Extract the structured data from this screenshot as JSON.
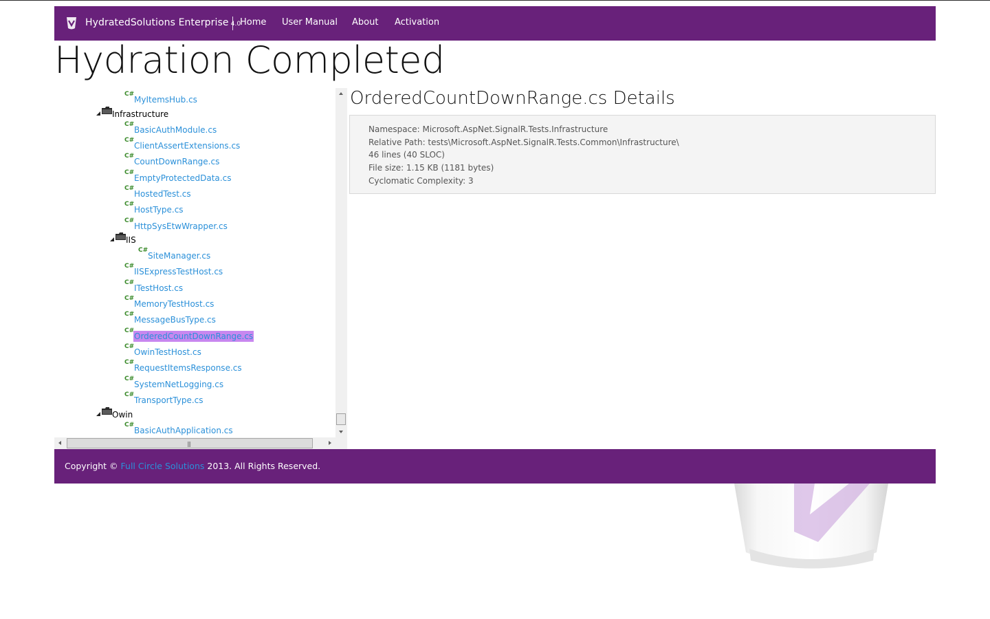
{
  "navbar": {
    "brand": "HydratedSolutions Enterprise",
    "version": "4.0",
    "links": [
      "Home",
      "User Manual",
      "About",
      "Activation"
    ]
  },
  "page": {
    "title": "Hydration Completed"
  },
  "tree": {
    "items": [
      {
        "type": "file",
        "label": "MyItemsHub.cs",
        "icon": "csharp-file-icon"
      },
      {
        "type": "folder",
        "label": "Infrastructure",
        "icon": "folder-icon"
      },
      {
        "type": "file",
        "label": "BasicAuthModule.cs"
      },
      {
        "type": "file",
        "label": "ClientAssertExtensions.cs"
      },
      {
        "type": "file",
        "label": "CountDownRange.cs"
      },
      {
        "type": "file",
        "label": "EmptyProtectedData.cs"
      },
      {
        "type": "file",
        "label": "HostedTest.cs"
      },
      {
        "type": "file",
        "label": "HostType.cs"
      },
      {
        "type": "file",
        "label": "HttpSysEtwWrapper.cs"
      },
      {
        "type": "folder",
        "label": "IIS"
      },
      {
        "type": "file",
        "label": "SiteManager.cs"
      },
      {
        "type": "file",
        "label": "IISExpressTestHost.cs"
      },
      {
        "type": "file",
        "label": "ITestHost.cs"
      },
      {
        "type": "file",
        "label": "MemoryTestHost.cs"
      },
      {
        "type": "file",
        "label": "MessageBusType.cs"
      },
      {
        "type": "file",
        "label": "OrderedCountDownRange.cs",
        "selected": true
      },
      {
        "type": "file",
        "label": "OwinTestHost.cs"
      },
      {
        "type": "file",
        "label": "RequestItemsResponse.cs"
      },
      {
        "type": "file",
        "label": "SystemNetLogging.cs"
      },
      {
        "type": "file",
        "label": "TransportType.cs"
      },
      {
        "type": "folder",
        "label": "Owin"
      },
      {
        "type": "file",
        "label": "BasicAuthApplication.cs"
      }
    ],
    "cs_glyph": "C#"
  },
  "details": {
    "title": "OrderedCountDownRange.cs Details",
    "namespace": "Namespace: Microsoft.AspNet.SignalR.Tests.Infrastructure",
    "relative_path": "Relative Path: tests\\Microsoft.AspNet.SignalR.Tests.Common\\Infrastructure\\",
    "lines": "46 lines (40 SLOC)",
    "file_size": "File size: 1.15 KB (1181 bytes)",
    "complexity": "Cyclomatic Complexity: 3"
  },
  "footer": {
    "prefix": "Copyright © ",
    "link": "Full Circle Solutions",
    "suffix": " 2013. All Rights Reserved."
  },
  "colors": {
    "brand_purple": "#68217a",
    "link_blue": "#2b90d9",
    "selection": "#c887ef",
    "csharp_green": "#3a8a2a"
  }
}
